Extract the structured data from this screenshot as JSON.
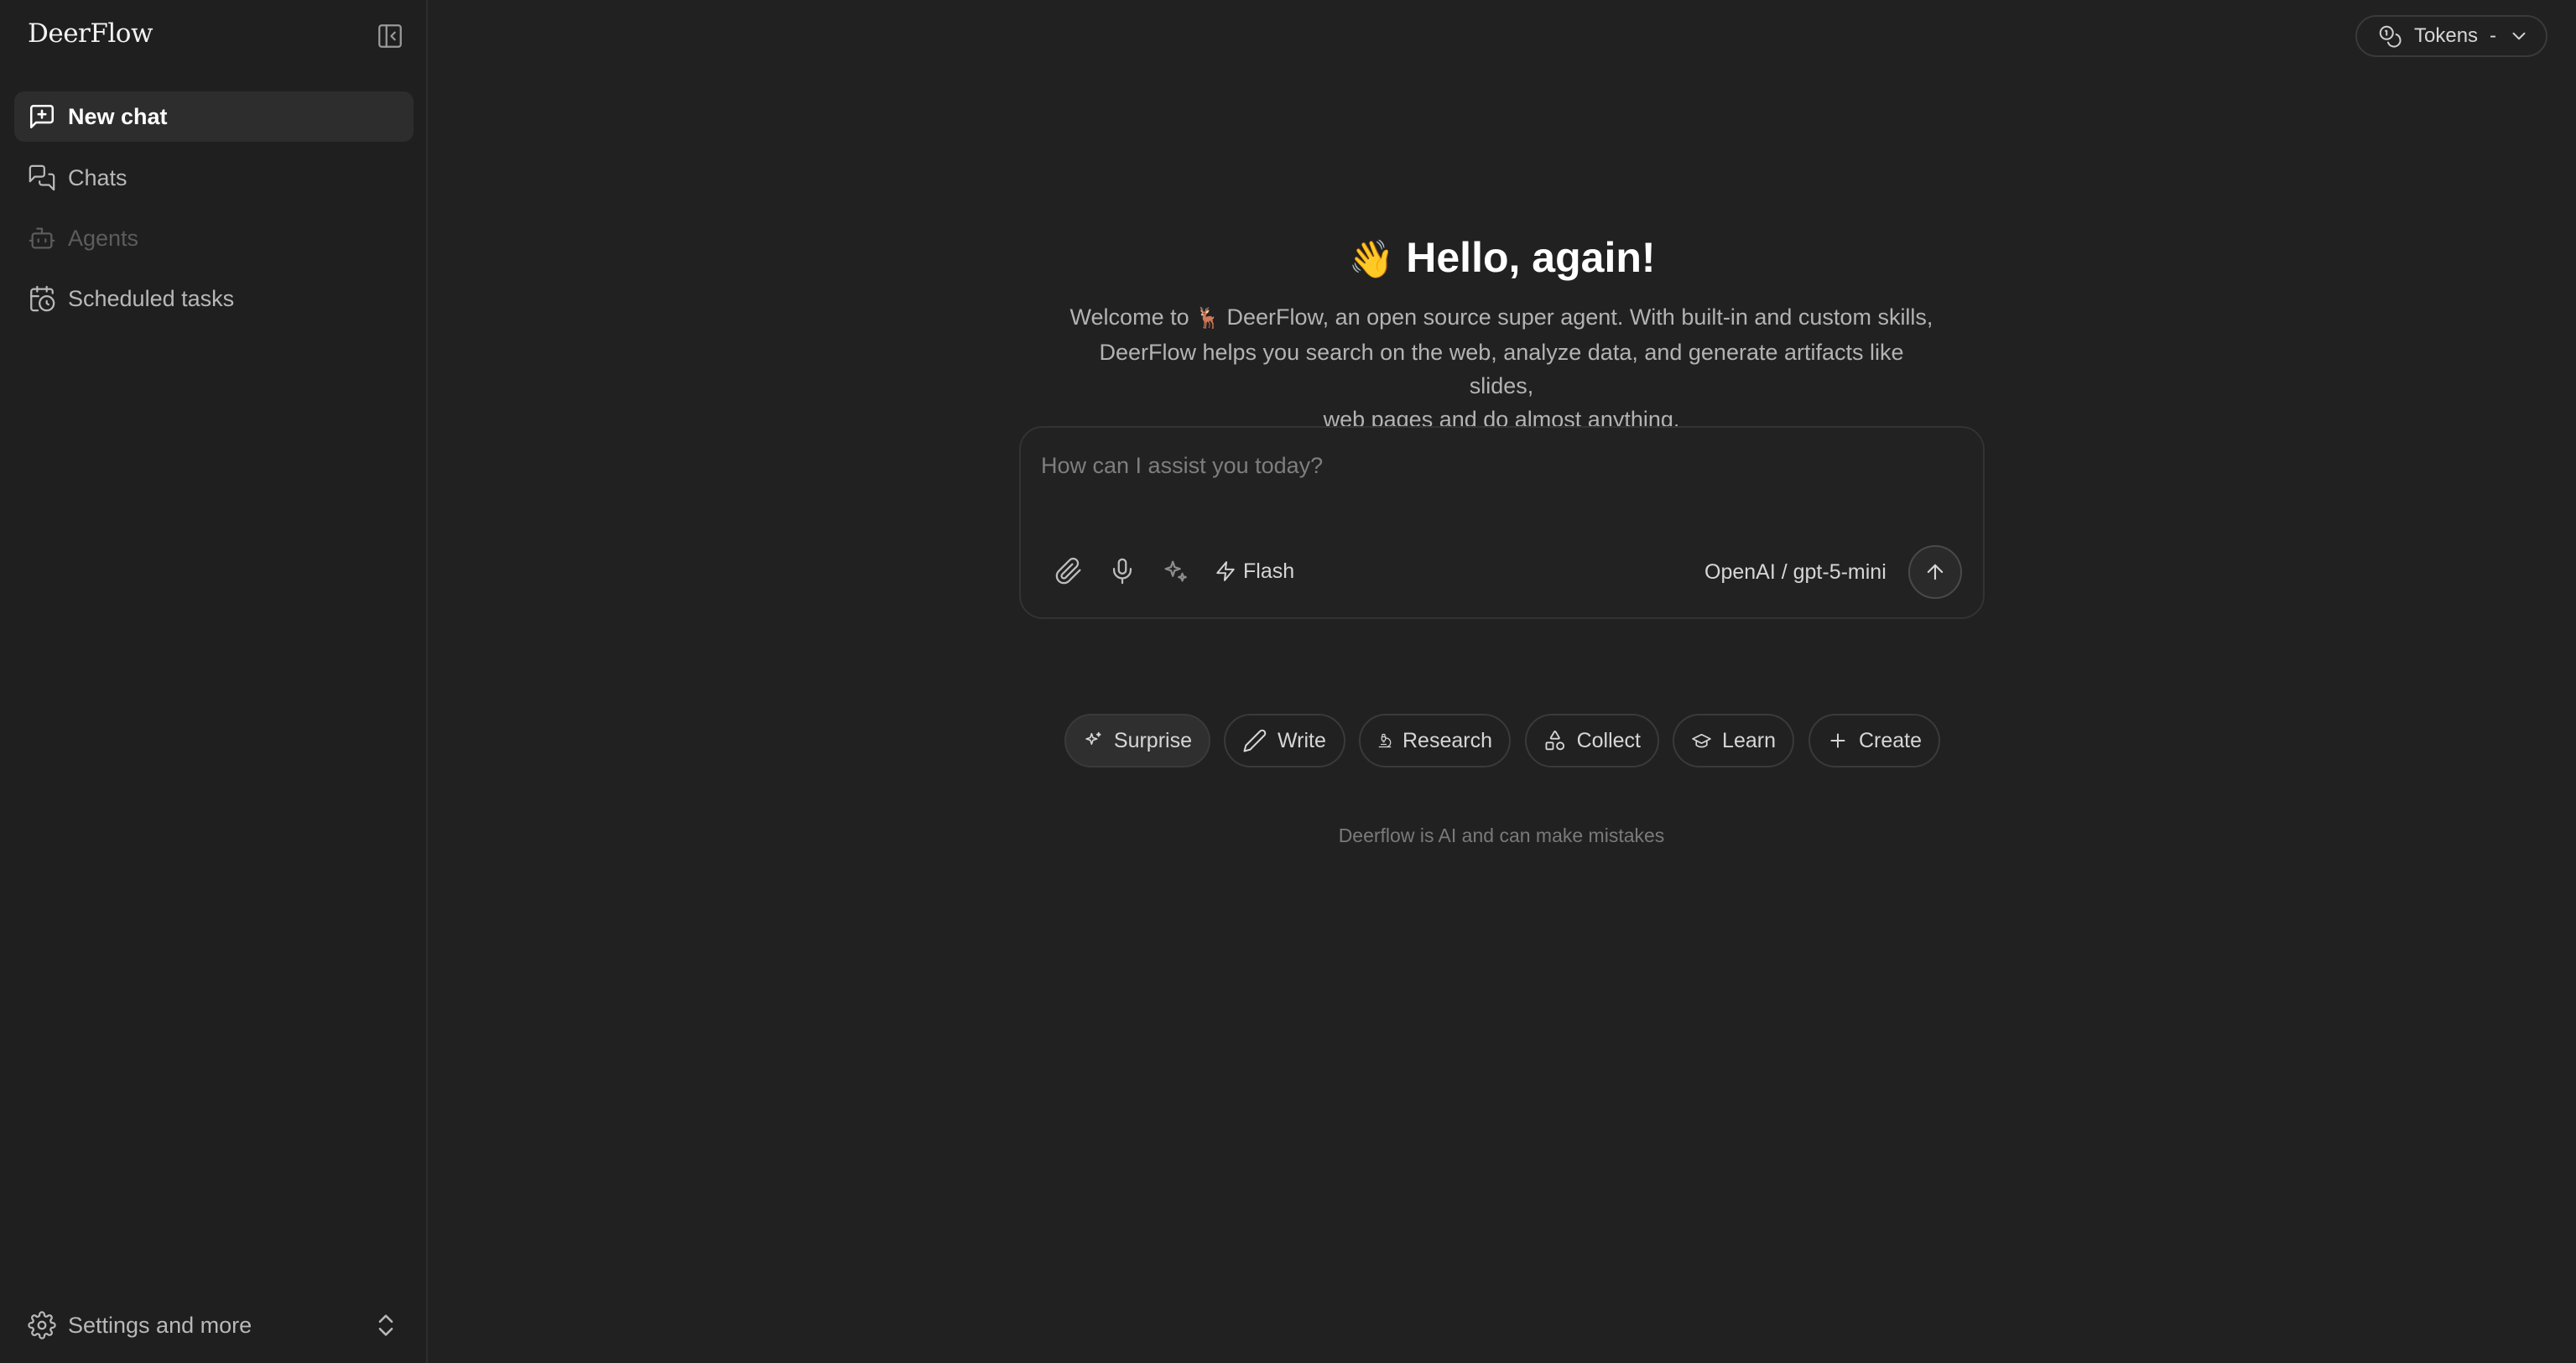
{
  "app": {
    "brand": "DeerFlow"
  },
  "sidebar": {
    "items": [
      {
        "label": "New chat",
        "icon": "new-chat-icon",
        "state": "active"
      },
      {
        "label": "Chats",
        "icon": "chats-icon",
        "state": "normal"
      },
      {
        "label": "Agents",
        "icon": "bot-icon",
        "state": "disabled"
      },
      {
        "label": "Scheduled tasks",
        "icon": "calendar-clock-icon",
        "state": "normal"
      }
    ],
    "settings_label": "Settings and more"
  },
  "header": {
    "tokens_label": "Tokens",
    "tokens_value": "-"
  },
  "hero": {
    "wave_emoji": "👋",
    "title": "Hello, again!",
    "desc_prefix": "Welcome to",
    "deer_emoji": "🦌",
    "desc_line1": "DeerFlow, an open source super agent. With built-in and custom skills,",
    "desc_line2": "DeerFlow helps you search on the web, analyze data, and generate artifacts like slides,",
    "desc_line3": "web pages and do almost anything."
  },
  "composer": {
    "placeholder": "How can I assist you today?",
    "mode_label": "Flash",
    "model_label": "OpenAI / gpt-5-mini"
  },
  "suggestions": [
    {
      "label": "Surprise",
      "icon": "sparkles-icon"
    },
    {
      "label": "Write",
      "icon": "pen-icon"
    },
    {
      "label": "Research",
      "icon": "microscope-icon"
    },
    {
      "label": "Collect",
      "icon": "shapes-icon"
    },
    {
      "label": "Learn",
      "icon": "graduation-cap-icon"
    },
    {
      "label": "Create",
      "icon": "plus-icon"
    }
  ],
  "disclaimer": "Deerflow is AI and can make mistakes",
  "colors": {
    "background": "#212121",
    "sidebar": "#1f1f1f",
    "active_item": "#2d2d2d",
    "text": "#ececec"
  }
}
